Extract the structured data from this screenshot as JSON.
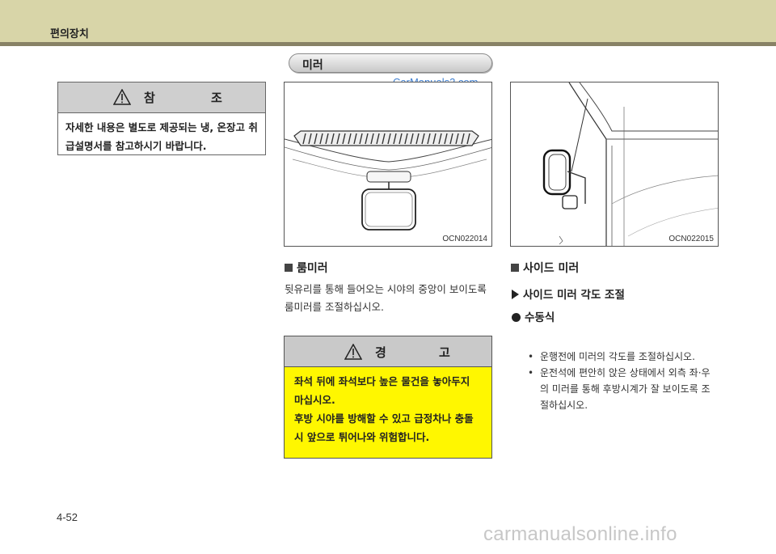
{
  "header": {
    "title": "편의장치"
  },
  "section_title": "미러",
  "watermark_top": "CarManuals2.com",
  "note": {
    "title": "참 조",
    "icon": "warning-triangle-icon",
    "body": "자세한 내용은 별도로 제공되는 냉, 온장고 취급설명서를 참고하시기 바랍니다."
  },
  "figures": [
    {
      "code": "OCN022014",
      "depicts": "room-mirror"
    },
    {
      "code": "OCN022015",
      "depicts": "side-mirror"
    }
  ],
  "room_mirror": {
    "heading": "룸미러",
    "text_line1": "뒷유리를 통해 들어오는 시야의 중앙이 보이도록",
    "text_line2": "룸미러를 조절하십시오."
  },
  "warning": {
    "title": "경 고",
    "icon": "warning-triangle-icon",
    "line1": "좌석 뒤에 좌석보다 높은 물건을 놓아두지",
    "line2": "마십시오.",
    "line3": "후방 시야를 방해할 수 있고 급정차나 충돌",
    "line4": "시 앞으로 튀어나와 위험합니다."
  },
  "side_mirror": {
    "heading": "사이드 미러",
    "sub_heading": "사이드 미러 각도 조절",
    "manual_heading": "수동식",
    "bullet1": "운행전에 미러의 각도를 조절하십시오.",
    "bullet2_line1": "운전석에 편안히 앉은 상태에서 외측 좌·우",
    "bullet2_line2": "의 미러를 통해 후방시계가 잘 보이도록 조",
    "bullet2_line3": "절하십시오."
  },
  "page_number": "4-52",
  "watermark_bottom": "carmanualsonline.info"
}
